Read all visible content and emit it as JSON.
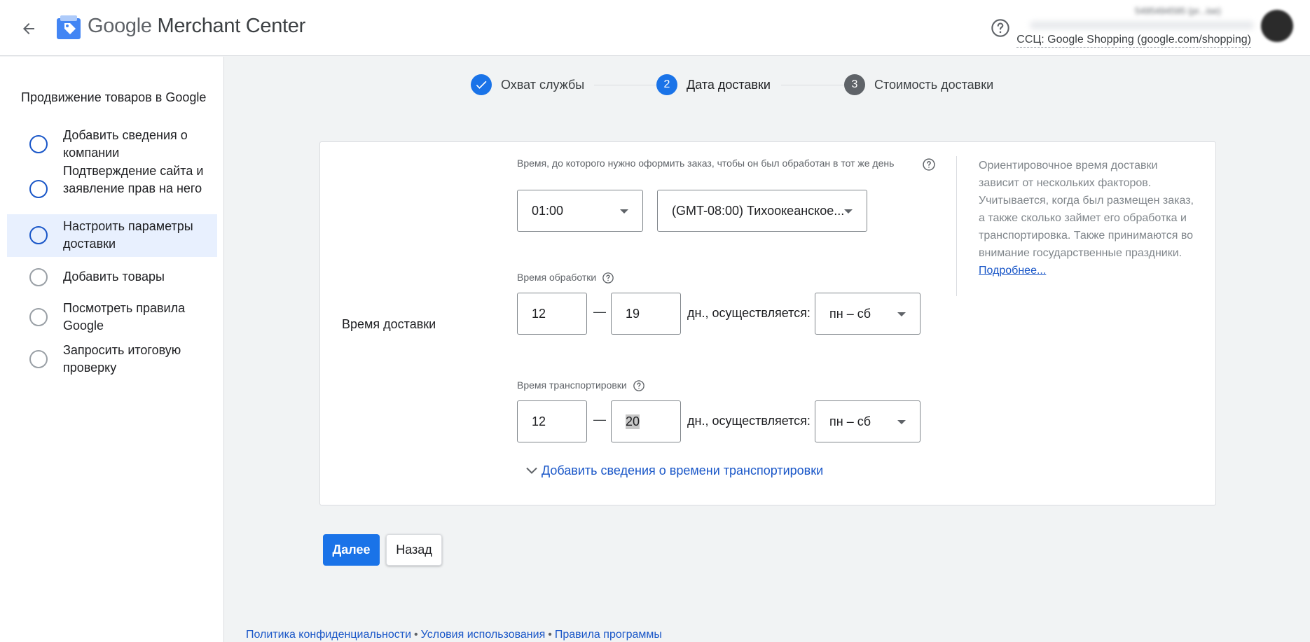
{
  "header": {
    "app_name_google": "Google",
    "app_name_product": "Merchant Center",
    "account_id": "5495494595 (pr...ise)",
    "account_name": "ССЦ: Google Shopping (google.com/shopping)"
  },
  "sidebar": {
    "title": "Продвижение товаров в Google",
    "items": [
      {
        "label": "Добавить сведения о компании"
      },
      {
        "label": "Подтверждение сайта и заявление прав на него"
      },
      {
        "label": "Настроить параметры доставки"
      },
      {
        "label": "Добавить товары"
      },
      {
        "label": "Посмотреть правила Google"
      },
      {
        "label": "Запросить итоговую проверку"
      }
    ]
  },
  "stepper": {
    "steps": [
      {
        "label": "Охват службы",
        "number": ""
      },
      {
        "label": "Дата доставки",
        "number": "2"
      },
      {
        "label": "Стоимость доставки",
        "number": "3"
      }
    ]
  },
  "form": {
    "section_label": "Время доставки",
    "cutoff_label": "Время, до которого нужно оформить заказ, чтобы он был обработан в тот же день",
    "cutoff_time": "01:00",
    "timezone": "(GMT-08:00) Тихоокеанское...",
    "handling_label": "Время обработки",
    "handling_min": "12",
    "handling_max": "19",
    "days_text": "дн., осуществляется:",
    "handling_days": "пн – сб",
    "transit_label": "Время транспортировки",
    "transit_min": "12",
    "transit_max": "20",
    "transit_days": "пн – сб",
    "dash": "—",
    "add_transit_link": "Добавить сведения о времени транспортировки"
  },
  "info": {
    "text": "Ориентировочное время доставки зависит от нескольких факторов. Учитывается, когда был размещен заказ, а также сколько займет его обработка и транспортировка. Также принимаются во внимание государственные праздники.",
    "link": "Подробнее..."
  },
  "buttons": {
    "next": "Далее",
    "back": "Назад"
  },
  "footer": {
    "privacy": "Политика конфиденциальности",
    "terms": "Условия использования",
    "rules": "Правила программы",
    "separator": "•"
  },
  "colors": {
    "accent": "#1a73e8",
    "link": "#1a57c8",
    "step_inactive": "#5f6368",
    "active_bg": "#e8f0fe"
  }
}
